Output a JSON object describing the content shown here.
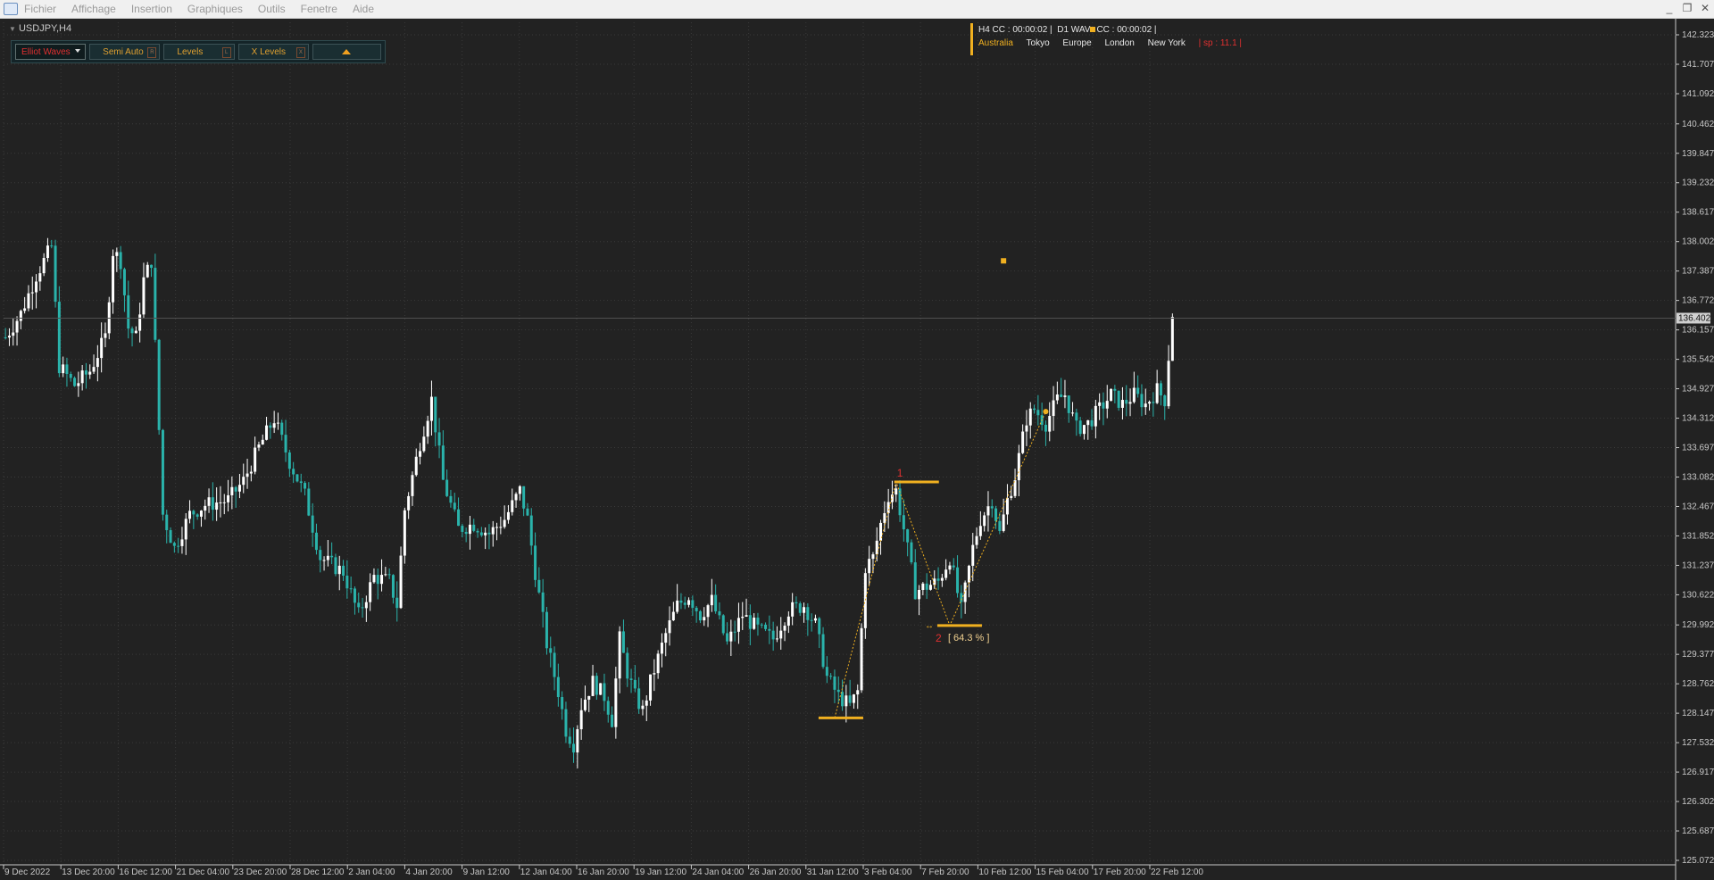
{
  "menu": {
    "items": [
      "Fichier",
      "Affichage",
      "Insertion",
      "Graphiques",
      "Outils",
      "Fenetre",
      "Aide"
    ]
  },
  "window_controls": [
    "_",
    "❐",
    "✕"
  ],
  "symbol": {
    "label": "USDJPY,H4"
  },
  "toolbar": {
    "mode_select": "Elliot Waves",
    "buttons": [
      {
        "label": "Semi Auto",
        "key": "R"
      },
      {
        "label": "Levels",
        "key": "L"
      },
      {
        "label": "X Levels",
        "key": "X"
      }
    ]
  },
  "info": {
    "h4": "H4 CC : 00:00:02  |",
    "d1a": "D1 WAV",
    "d1b": "CC : 00:00:02  |",
    "sessions": [
      "Australia",
      "Tokyo",
      "Europe",
      "London",
      "New York"
    ],
    "spread": "|  sp : 11.1  |"
  },
  "colors": {
    "background": "#222222",
    "grid": "#3a3a3a",
    "bull_candle": "#ffffff",
    "bear_candle": "#2ab3ab",
    "wave": "#f0b020",
    "wave_label": "#e03030",
    "price_tag_bg": "#d0d0d0"
  },
  "chart_data": {
    "type": "candlestick",
    "symbol": "USDJPY",
    "timeframe": "H4",
    "ylim": [
      125.0,
      142.4
    ],
    "y_ticks": [
      "142.323",
      "141.707",
      "141.092",
      "140.462",
      "139.847",
      "139.232",
      "138.617",
      "138.002",
      "137.387",
      "136.772",
      "136.157",
      "135.542",
      "134.927",
      "134.312",
      "133.697",
      "133.082",
      "132.467",
      "131.852",
      "131.237",
      "130.622",
      "129.992",
      "129.377",
      "128.762",
      "128.147",
      "127.532",
      "126.917",
      "126.302",
      "125.687",
      "125.072"
    ],
    "x_ticks": [
      "9 Dec 2022",
      "13 Dec 20:00",
      "16 Dec 12:00",
      "21 Dec 04:00",
      "23 Dec 20:00",
      "28 Dec 12:00",
      "2 Jan 04:00",
      "4 Jan 20:00",
      "9 Jan 12:00",
      "12 Jan 04:00",
      "16 Jan 20:00",
      "19 Jan 12:00",
      "24 Jan 04:00",
      "26 Jan 20:00",
      "31 Jan 12:00",
      "3 Feb 04:00",
      "7 Feb 20:00",
      "10 Feb 12:00",
      "15 Feb 04:00",
      "17 Feb 20:00",
      "22 Feb 12:00"
    ],
    "current_price": "136.402",
    "close_path": [
      [
        0,
        136.0
      ],
      [
        4,
        136.5
      ],
      [
        8,
        137.3
      ],
      [
        12,
        137.9
      ],
      [
        14,
        135.4
      ],
      [
        18,
        135.0
      ],
      [
        22,
        135.3
      ],
      [
        26,
        136.0
      ],
      [
        28,
        137.8
      ],
      [
        30,
        137.6
      ],
      [
        32,
        136.2
      ],
      [
        34,
        136.0
      ],
      [
        36,
        137.2
      ],
      [
        38,
        137.6
      ],
      [
        41,
        132.3
      ],
      [
        44,
        131.6
      ],
      [
        48,
        132.3
      ],
      [
        52,
        132.5
      ],
      [
        58,
        132.6
      ],
      [
        62,
        133.0
      ],
      [
        66,
        133.7
      ],
      [
        70,
        134.3
      ],
      [
        74,
        133.4
      ],
      [
        78,
        132.7
      ],
      [
        82,
        131.4
      ],
      [
        88,
        131.1
      ],
      [
        92,
        130.2
      ],
      [
        96,
        131.0
      ],
      [
        100,
        130.9
      ],
      [
        102,
        130.4
      ],
      [
        104,
        132.4
      ],
      [
        108,
        133.8
      ],
      [
        111,
        134.7
      ],
      [
        114,
        133.0
      ],
      [
        118,
        132.0
      ],
      [
        122,
        132.1
      ],
      [
        126,
        131.9
      ],
      [
        130,
        132.2
      ],
      [
        134,
        132.8
      ],
      [
        136,
        132.2
      ],
      [
        138,
        131.1
      ],
      [
        141,
        129.6
      ],
      [
        144,
        128.6
      ],
      [
        146,
        127.8
      ],
      [
        148,
        127.5
      ],
      [
        150,
        128.3
      ],
      [
        153,
        128.8
      ],
      [
        156,
        128.5
      ],
      [
        158,
        128.0
      ],
      [
        160,
        129.7
      ],
      [
        162,
        129.0
      ],
      [
        164,
        128.5
      ],
      [
        166,
        128.2
      ],
      [
        168,
        128.8
      ],
      [
        172,
        129.8
      ],
      [
        175,
        130.4
      ],
      [
        178,
        130.6
      ],
      [
        181,
        130.2
      ],
      [
        184,
        130.5
      ],
      [
        188,
        129.6
      ],
      [
        192,
        130.2
      ],
      [
        196,
        129.9
      ],
      [
        200,
        129.7
      ],
      [
        204,
        130.3
      ],
      [
        208,
        130.4
      ],
      [
        211,
        130.0
      ],
      [
        214,
        128.9
      ],
      [
        217,
        128.5
      ],
      [
        220,
        128.3
      ],
      [
        222,
        128.6
      ],
      [
        224,
        131.2
      ],
      [
        226,
        131.4
      ],
      [
        228,
        132.1
      ],
      [
        230,
        132.7
      ],
      [
        232,
        132.8
      ],
      [
        234,
        132.0
      ],
      [
        237,
        130.7
      ],
      [
        240,
        130.8
      ],
      [
        243,
        130.9
      ],
      [
        246,
        131.4
      ],
      [
        249,
        130.3
      ],
      [
        252,
        131.6
      ],
      [
        254,
        132.2
      ],
      [
        257,
        132.6
      ],
      [
        259,
        131.9
      ],
      [
        261,
        132.6
      ],
      [
        263,
        133.1
      ],
      [
        266,
        134.3
      ],
      [
        268,
        134.5
      ],
      [
        271,
        134.2
      ],
      [
        274,
        134.7
      ],
      [
        276,
        134.8
      ],
      [
        279,
        134.1
      ],
      [
        282,
        134.2
      ],
      [
        285,
        134.5
      ],
      [
        288,
        134.8
      ],
      [
        291,
        134.6
      ],
      [
        294,
        134.8
      ],
      [
        297,
        134.6
      ],
      [
        300,
        134.9
      ],
      [
        302,
        134.7
      ],
      [
        304,
        136.5
      ]
    ]
  },
  "annotations": {
    "wave1_label": "1",
    "wave2_label": "2",
    "retrace_label": "[ 64.3 % ]",
    "arrow_symbol": "↔"
  }
}
